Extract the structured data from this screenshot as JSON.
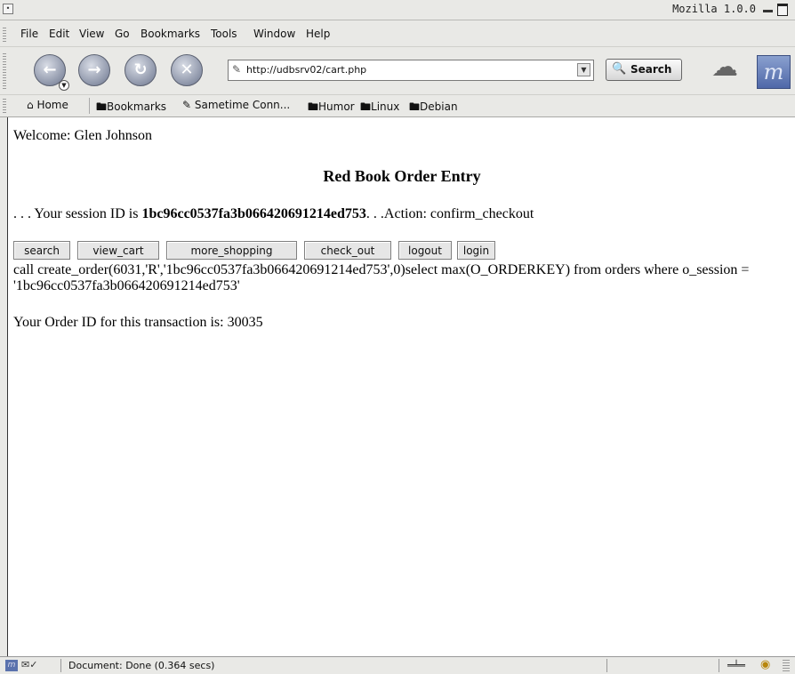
{
  "window": {
    "title": "Mozilla 1.0.0"
  },
  "menu": [
    "File",
    "Edit",
    "View",
    "Go",
    "Bookmarks",
    "Tools",
    "Window",
    "Help"
  ],
  "nav": {
    "url": "http://udbsrv02/cart.php",
    "search_label": "Search",
    "icons": [
      "back-icon",
      "forward-icon",
      "reload-icon",
      "stop-icon"
    ]
  },
  "personal_toolbar": {
    "items": [
      "Home",
      "Bookmarks",
      "Sametime Conn...",
      "Humor",
      "Linux",
      "Debian"
    ]
  },
  "page": {
    "welcome": "Welcome: Glen Johnson",
    "title": "Red Book Order Entry",
    "session_prefix": ". . . Your session ID is ",
    "session_id": "1bc96cc0537fa3b066420691214ed753",
    "session_suffix": ". . .Action: confirm_checkout",
    "buttons": [
      "search",
      "view_cart",
      "more_shopping",
      "check_out",
      "logout",
      "login"
    ],
    "sql_text": "call create_order(6031,'R','1bc96cc0537fa3b066420691214ed753',0)select max(O_ORDERKEY) from orders where o_session = '1bc96cc0537fa3b066420691214ed753'",
    "order_line": "Your Order ID for this transaction is: 30035"
  },
  "status": {
    "text": "Document: Done (0.364 secs)"
  }
}
